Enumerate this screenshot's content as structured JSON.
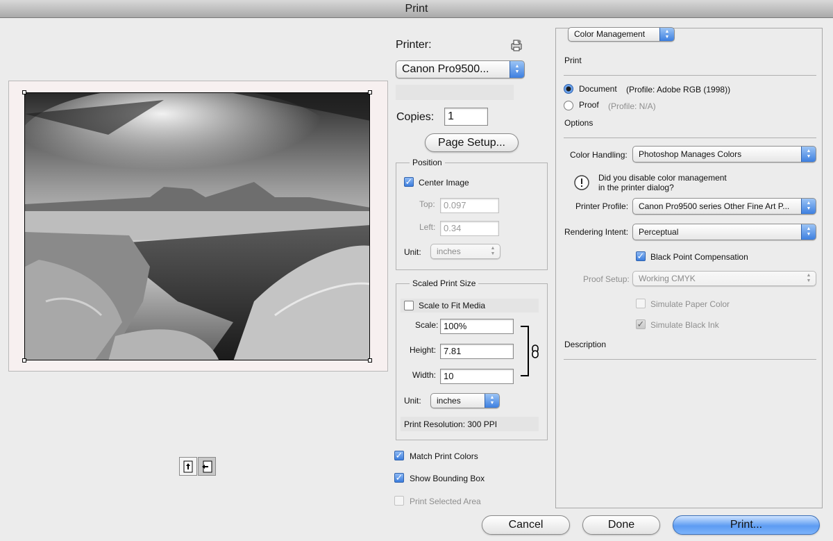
{
  "window": {
    "title": "Print"
  },
  "printer": {
    "label": "Printer:",
    "value": "Canon Pro9500..."
  },
  "copies": {
    "label": "Copies:",
    "value": "1"
  },
  "page_setup": {
    "label": "Page Setup..."
  },
  "position": {
    "title": "Position",
    "center_image": {
      "label": "Center Image",
      "checked": true
    },
    "top": {
      "label": "Top:",
      "value": "0.097"
    },
    "left": {
      "label": "Left:",
      "value": "0.34"
    },
    "unit": {
      "label": "Unit:",
      "value": "inches"
    }
  },
  "scaled": {
    "title": "Scaled Print Size",
    "scale_to_fit": {
      "label": "Scale to Fit Media",
      "checked": false
    },
    "scale": {
      "label": "Scale:",
      "value": "100%"
    },
    "height": {
      "label": "Height:",
      "value": "7.81"
    },
    "width": {
      "label": "Width:",
      "value": "10"
    },
    "unit": {
      "label": "Unit:",
      "value": "inches"
    },
    "resolution": "Print Resolution: 300 PPI"
  },
  "options": {
    "match_print_colors": {
      "label": "Match Print Colors",
      "checked": true
    },
    "show_bounding_box": {
      "label": "Show Bounding Box",
      "checked": true
    },
    "print_selected_area": {
      "label": "Print Selected Area",
      "checked": false
    }
  },
  "color": {
    "menu": "Color Management",
    "print_heading": "Print",
    "document": {
      "label": "Document",
      "profile": "(Profile: Adobe RGB (1998))",
      "selected": true
    },
    "proof": {
      "label": "Proof",
      "profile": "(Profile: N/A)",
      "selected": false
    },
    "options_heading": "Options",
    "color_handling": {
      "label": "Color Handling:",
      "value": "Photoshop Manages Colors"
    },
    "warning_line1": "Did you disable color management",
    "warning_line2": "in the printer dialog?",
    "printer_profile": {
      "label": "Printer Profile:",
      "value": "Canon Pro9500 series Other Fine Art P..."
    },
    "rendering_intent": {
      "label": "Rendering Intent:",
      "value": "Perceptual"
    },
    "black_point": {
      "label": "Black Point Compensation",
      "checked": true
    },
    "proof_setup": {
      "label": "Proof Setup:",
      "value": "Working CMYK"
    },
    "simulate_paper": {
      "label": "Simulate Paper Color",
      "checked": false
    },
    "simulate_black": {
      "label": "Simulate Black Ink",
      "checked": true
    },
    "description_heading": "Description"
  },
  "buttons": {
    "cancel": "Cancel",
    "done": "Done",
    "print": "Print..."
  },
  "icons": {
    "printer_settings": "printer-settings-icon",
    "portrait": "portrait-orientation-icon",
    "landscape": "landscape-orientation-icon",
    "link": "chain-link-icon",
    "warning": "warning-icon"
  }
}
